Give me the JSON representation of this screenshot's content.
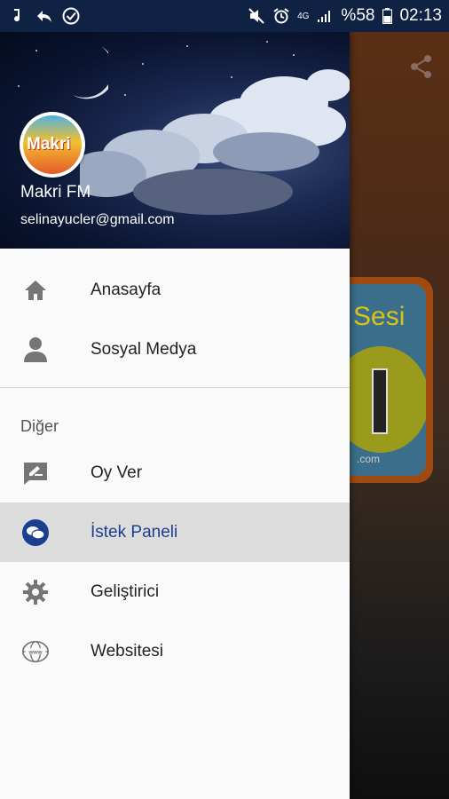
{
  "status_bar": {
    "battery_percent": "%58",
    "time": "02:13",
    "network": "4G"
  },
  "drawer": {
    "header": {
      "name": "Makri FM",
      "email": "selinayucler@gmail.com",
      "avatar_text": "Makri"
    },
    "items": [
      {
        "label": "Anasayfa",
        "icon": "home-icon"
      },
      {
        "label": "Sosyal Medya",
        "icon": "person-icon"
      }
    ],
    "section_title": "Diğer",
    "other_items": [
      {
        "label": "Oy Ver",
        "icon": "rate-icon"
      },
      {
        "label": "İstek Paneli",
        "icon": "chat-icon",
        "active": true
      },
      {
        "label": "Geliştirici",
        "icon": "gear-icon"
      },
      {
        "label": "Websitesi",
        "icon": "web-icon"
      }
    ]
  },
  "background": {
    "logo_text": "Sesi",
    "logo_domain": ".com"
  },
  "colors": {
    "status_bar": "#0f2244",
    "active_item": "#dcdcdc",
    "active_text": "#1a3f8f",
    "icon_gray": "#757575"
  }
}
